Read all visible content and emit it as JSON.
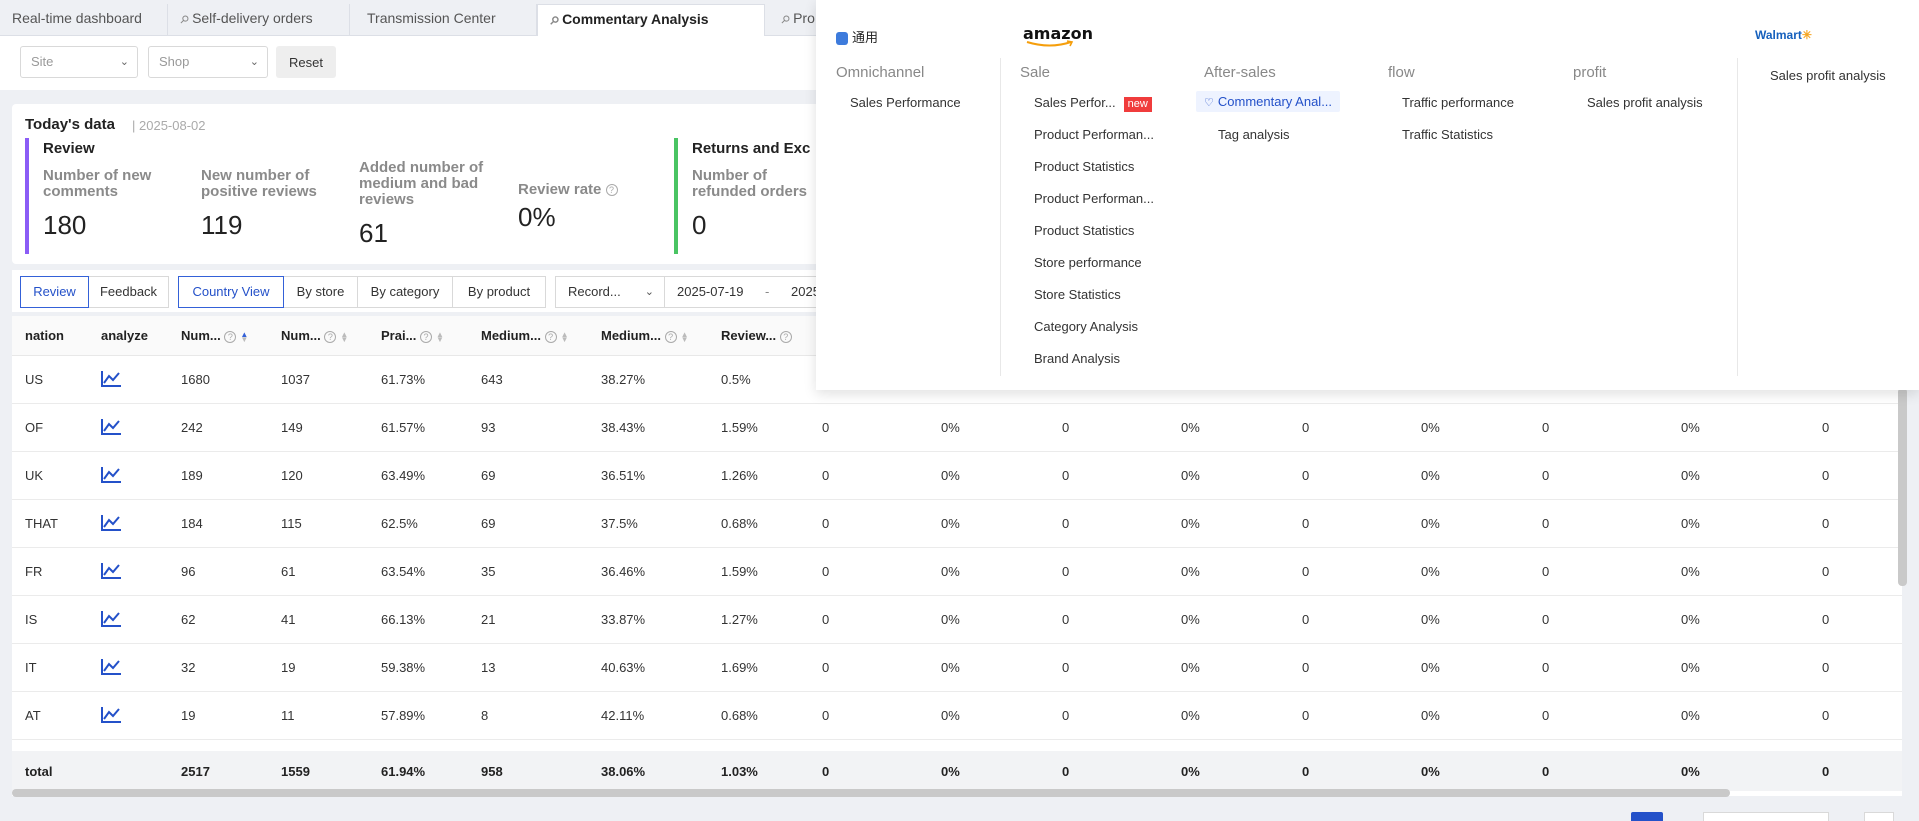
{
  "tabs": [
    {
      "label": "Real-time dashboard",
      "pinned": false
    },
    {
      "label": "Self-delivery orders",
      "pinned": true
    },
    {
      "label": "Transmission Center",
      "pinned": false
    },
    {
      "label": "Commentary Analysis",
      "pinned": true,
      "active": true
    },
    {
      "label": "Pro",
      "pinned": true
    }
  ],
  "filters": {
    "site_placeholder": "Site",
    "shop_placeholder": "Shop",
    "reset_label": "Reset"
  },
  "today": {
    "title": "Today's data",
    "date": "2025-08-02",
    "review": {
      "title": "Review",
      "metrics": [
        {
          "label": "Number of new comments",
          "value": "180"
        },
        {
          "label": "New number of positive reviews",
          "value": "119"
        },
        {
          "label": "Added number of medium and bad reviews",
          "value": "61"
        },
        {
          "label": "Review rate",
          "value": "0%"
        }
      ]
    },
    "returns": {
      "title": "Returns and Exc",
      "metrics": [
        {
          "label": "Number of refunded orders",
          "value": "0"
        }
      ]
    }
  },
  "toolbar": {
    "mode": [
      "Review",
      "Feedback"
    ],
    "views": [
      "Country View",
      "By store",
      "By category",
      "By product"
    ],
    "range_label": "Record...",
    "date_start": "2025-07-19",
    "date_sep": "-",
    "date_end": "2025-"
  },
  "table": {
    "headers": [
      "nation",
      "analyze",
      "Num...",
      "Num...",
      "Prai...",
      "Medium...",
      "Medium...",
      "Review..."
    ],
    "rows": [
      {
        "nation": "US",
        "c1": "1680",
        "c2": "1037",
        "c3": "61.73%",
        "c4": "643",
        "c5": "38.27%",
        "c6": "0.5%",
        "rest": []
      },
      {
        "nation": "OF",
        "c1": "242",
        "c2": "149",
        "c3": "61.57%",
        "c4": "93",
        "c5": "38.43%",
        "c6": "1.59%",
        "rest": [
          "0",
          "0%",
          "0",
          "0%",
          "0",
          "0%",
          "0",
          "0%",
          "0"
        ]
      },
      {
        "nation": "UK",
        "c1": "189",
        "c2": "120",
        "c3": "63.49%",
        "c4": "69",
        "c5": "36.51%",
        "c6": "1.26%",
        "rest": [
          "0",
          "0%",
          "0",
          "0%",
          "0",
          "0%",
          "0",
          "0%",
          "0"
        ]
      },
      {
        "nation": "THAT",
        "c1": "184",
        "c2": "115",
        "c3": "62.5%",
        "c4": "69",
        "c5": "37.5%",
        "c6": "0.68%",
        "rest": [
          "0",
          "0%",
          "0",
          "0%",
          "0",
          "0%",
          "0",
          "0%",
          "0"
        ]
      },
      {
        "nation": "FR",
        "c1": "96",
        "c2": "61",
        "c3": "63.54%",
        "c4": "35",
        "c5": "36.46%",
        "c6": "1.59%",
        "rest": [
          "0",
          "0%",
          "0",
          "0%",
          "0",
          "0%",
          "0",
          "0%",
          "0"
        ]
      },
      {
        "nation": "IS",
        "c1": "62",
        "c2": "41",
        "c3": "66.13%",
        "c4": "21",
        "c5": "33.87%",
        "c6": "1.27%",
        "rest": [
          "0",
          "0%",
          "0",
          "0%",
          "0",
          "0%",
          "0",
          "0%",
          "0"
        ]
      },
      {
        "nation": "IT",
        "c1": "32",
        "c2": "19",
        "c3": "59.38%",
        "c4": "13",
        "c5": "40.63%",
        "c6": "1.69%",
        "rest": [
          "0",
          "0%",
          "0",
          "0%",
          "0",
          "0%",
          "0",
          "0%",
          "0"
        ]
      },
      {
        "nation": "AT",
        "c1": "19",
        "c2": "11",
        "c3": "57.89%",
        "c4": "8",
        "c5": "42.11%",
        "c6": "0.68%",
        "rest": [
          "0",
          "0%",
          "0",
          "0%",
          "0",
          "0%",
          "0",
          "0%",
          "0"
        ]
      }
    ],
    "total": {
      "nation": "total",
      "c1": "2517",
      "c2": "1559",
      "c3": "61.94%",
      "c4": "958",
      "c5": "38.06%",
      "c6": "1.03%",
      "rest": [
        "0",
        "0%",
        "0",
        "0%",
        "0",
        "0%",
        "0",
        "0%",
        "0"
      ]
    }
  },
  "menu": {
    "brands": {
      "general": "通用",
      "amazon": "amazon",
      "walmart": "Walmart"
    },
    "omnichannel": {
      "title": "Omnichannel",
      "items": [
        "Sales Performance"
      ]
    },
    "sale": {
      "title": "Sale",
      "badge": "new",
      "items": [
        "Sales Perfor...",
        "Product Performan...",
        "Product Statistics",
        "Product Performan...",
        "Product Statistics",
        "Store performance",
        "Store Statistics",
        "Category Analysis",
        "Brand Analysis"
      ]
    },
    "aftersales": {
      "title": "After-sales",
      "items": [
        "Commentary Anal...",
        "Tag analysis"
      ]
    },
    "flow": {
      "title": "flow",
      "items": [
        "Traffic performance",
        "Traffic Statistics"
      ]
    },
    "profit": {
      "title": "profit",
      "items": [
        "Sales profit analysis"
      ]
    },
    "walmart_items": [
      "Sales profit analysis"
    ]
  },
  "colors": {
    "accent": "#3461d8",
    "review_bar": "#8b5cf6",
    "returns_bar": "#49c463",
    "new_badge": "#f03c3c"
  }
}
